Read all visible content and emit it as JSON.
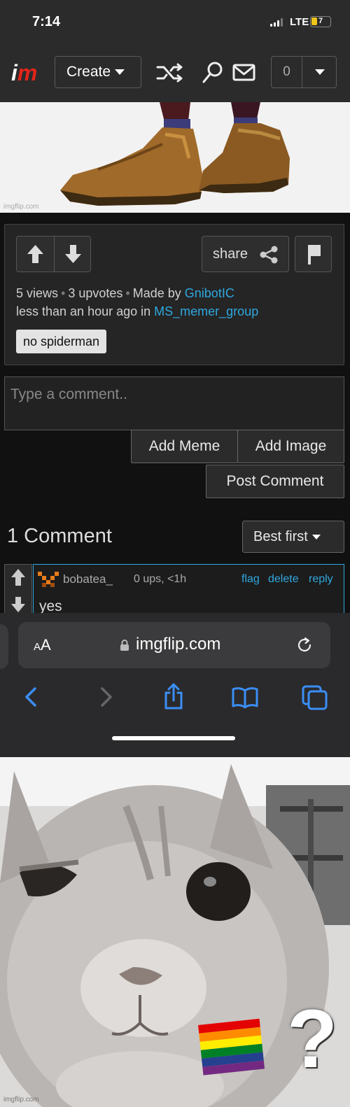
{
  "status_bar": {
    "time": "7:14",
    "network": "LTE",
    "battery_level": "7",
    "battery_color": "#f0c419"
  },
  "navbar": {
    "logo": {
      "i": "i",
      "m": "m"
    },
    "create_label": "Create",
    "icons": [
      "shuffle-icon",
      "search-icon",
      "mail-icon"
    ],
    "notification_count": "0"
  },
  "post": {
    "watermark": "imgflip.com",
    "share_label": "share",
    "views": "5 views",
    "upvotes": "3 upvotes",
    "made_by_prefix": "Made by",
    "author": "GnibotIC",
    "posted_prefix": "less than an hour ago in",
    "stream": "MS_memer_group",
    "tag": "no spiderman"
  },
  "comment_form": {
    "placeholder": "Type a comment..",
    "add_meme": "Add Meme",
    "add_image": "Add Image",
    "post_comment": "Post Comment"
  },
  "comments": {
    "title": "1 Comment",
    "sort_label": "Best first",
    "items": [
      {
        "user": "bobatea_",
        "meta": "0 ups, <1h",
        "actions": [
          "flag",
          "delete",
          "reply"
        ],
        "text": "yes"
      }
    ]
  },
  "safari": {
    "text_size_small": "A",
    "text_size_large": "A",
    "url": "imgflip.com",
    "toolbar": [
      "back-icon",
      "forward-icon",
      "share-icon",
      "bookmarks-icon",
      "tabs-icon"
    ]
  },
  "cat_meme": {
    "emoji": "🏳️‍🌈",
    "text": "?",
    "watermark": "imgflip.com"
  },
  "colors": {
    "accent_link": "#2fa8e0",
    "brand_red": "#e2241a",
    "dark_bg": "#111111"
  }
}
